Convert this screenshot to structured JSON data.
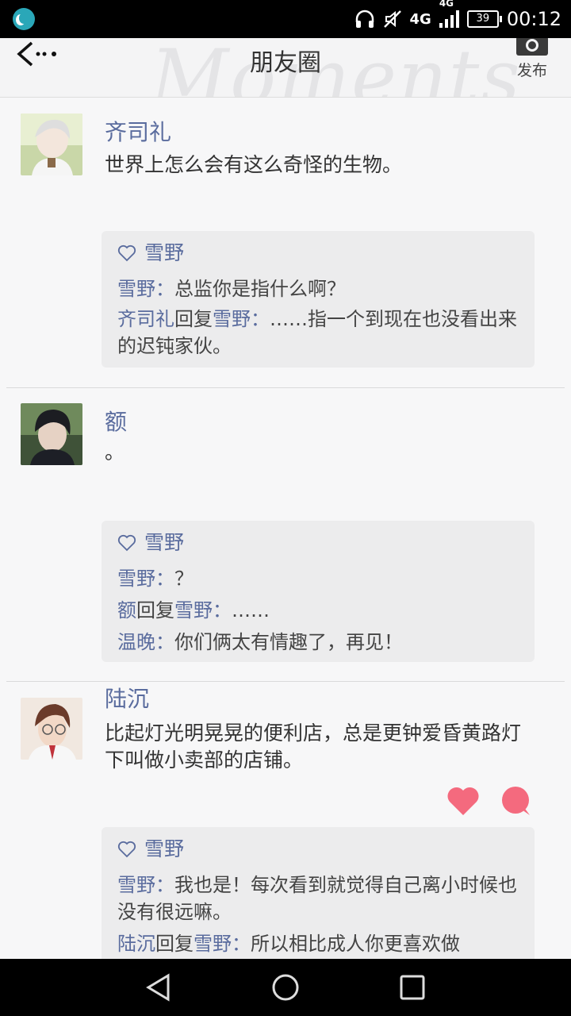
{
  "status_bar": {
    "network": "4G",
    "network_small": "4G",
    "battery": "39",
    "time": "00:12",
    "icons": [
      "app-moon-icon",
      "headphones-icon",
      "mute-icon",
      "signal-icon",
      "battery-icon"
    ]
  },
  "header": {
    "watermark": "Moments",
    "title": "朋友圈",
    "publish_label": "发布"
  },
  "colors": {
    "name": "#5a6c9e",
    "heart": "#f46a7e",
    "comment_bg": "#ececed"
  },
  "posts": [
    {
      "author": "齐司礼",
      "text": "世界上怎么会有这么奇怪的生物。",
      "likes": "雪野",
      "comments": [
        {
          "name": "雪野",
          "sep": "：",
          "text": "总监你是指什么啊？"
        },
        {
          "name": "齐司礼",
          "reply": "回复",
          "target": "雪野",
          "sep": "：",
          "text": "……指一个到现在也没看出来的迟钝家伙。"
        }
      ]
    },
    {
      "author": "额",
      "text": "。",
      "likes": "雪野",
      "comments": [
        {
          "name": "雪野",
          "sep": "：",
          "text": "？"
        },
        {
          "name": "额",
          "reply": "回复",
          "target": "雪野",
          "sep": "：",
          "text": "……"
        },
        {
          "name": "温晚",
          "sep": "：",
          "text": "你们俩太有情趣了，再见！"
        }
      ]
    },
    {
      "author": "陆沉",
      "text": "比起灯光明晃晃的便利店，总是更钟爱昏黄路灯下叫做小卖部的店铺。",
      "likes": "雪野",
      "comments": [
        {
          "name": "雪野",
          "sep": "：",
          "text": "我也是！每次看到就觉得自己离小时候也没有很远嘛。"
        },
        {
          "name": "陆沉",
          "reply": "回复",
          "target": "雪野",
          "sep": "：",
          "text": "所以相比成人你更喜欢做"
        }
      ]
    }
  ]
}
